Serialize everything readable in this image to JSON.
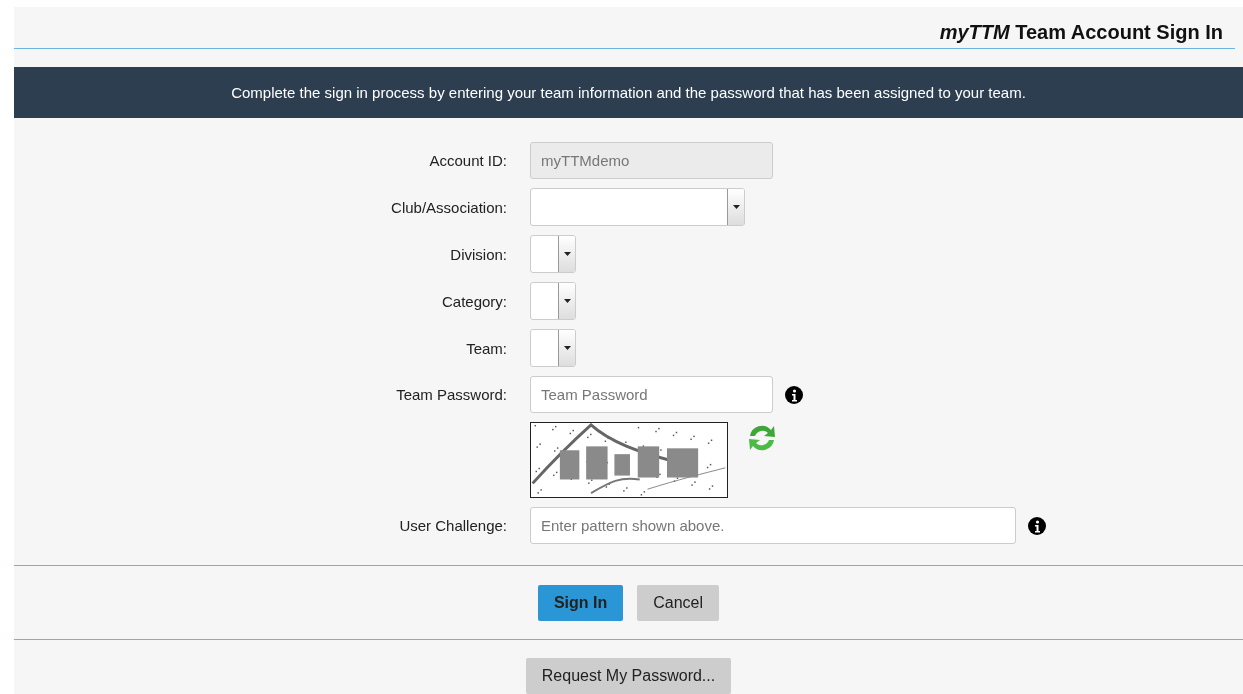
{
  "header": {
    "title": "*myTTM* Team Account Sign In"
  },
  "banner": {
    "text": "Complete the sign in process by entering your team information and the password that has been assigned to your team."
  },
  "fields": [
    {
      "kind": "text",
      "label": "Account ID:",
      "value": "myTTMdemo",
      "disabled": true,
      "info": false
    },
    {
      "kind": "select",
      "label": "Club/Association:",
      "wide": true
    },
    {
      "kind": "select",
      "label": "Division:",
      "wide": false
    },
    {
      "kind": "select",
      "label": "Category:",
      "wide": false
    },
    {
      "kind": "select",
      "label": "Team:",
      "wide": false
    },
    {
      "kind": "text",
      "label": "Team Password:",
      "placeholder": "Team Password",
      "disabled": false,
      "info": true
    },
    {
      "kind": "captcha"
    },
    {
      "kind": "text",
      "label": "User Challenge:",
      "placeholder": "Enter pattern shown above.",
      "disabled": false,
      "info": true,
      "long": true
    }
  ],
  "actions": [
    {
      "label": "Sign In",
      "primary": true
    },
    {
      "label": "Cancel",
      "primary": false
    }
  ],
  "footer": {
    "button": "Request My Password..."
  }
}
